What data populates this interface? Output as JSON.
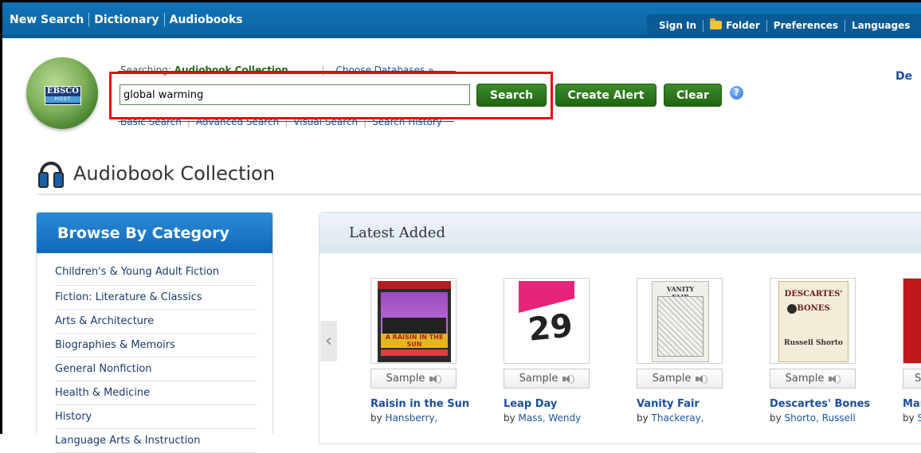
{
  "topnav": {
    "items": [
      "New Search",
      "Dictionary",
      "Audiobooks"
    ]
  },
  "toolbar": {
    "sign_in": "Sign In",
    "folder": "Folder",
    "preferences": "Preferences",
    "languages": "Languages"
  },
  "logo": {
    "line1": "EBSCO",
    "line2": "HOST"
  },
  "search": {
    "searching_label": "Searching:",
    "database": "Audiobook Collection",
    "choose_databases": "Choose Databases »",
    "query": "global warming",
    "search_button": "Search",
    "create_alert_button": "Create Alert",
    "clear_button": "Clear",
    "help": "?",
    "links": [
      "Basic Search",
      "Advanced Search",
      "Visual Search",
      "Search History"
    ]
  },
  "right_link": "De",
  "page_title": "Audiobook Collection",
  "browse": {
    "title": "Browse By Category",
    "categories": [
      "Children's & Young Adult Fiction",
      "Fiction: Literature & Classics",
      "Arts & Architecture",
      "Biographies & Memoirs",
      "General Nonfiction",
      "Health & Medicine",
      "History",
      "Language Arts & Instruction"
    ]
  },
  "latest": {
    "title": "Latest Added",
    "prev_arrow": "‹",
    "sample_label": "Sample",
    "books": [
      {
        "title": "Raisin in the Sun",
        "by": "by",
        "author": "Hansberry,",
        "cover_text": "A RAISIN IN THE SUN"
      },
      {
        "title": "Leap Day",
        "by": "by",
        "author": "Mass, Wendy",
        "cover_text": "29"
      },
      {
        "title": "Vanity Fair",
        "by": "by",
        "author": "Thackeray,",
        "cover_text": "VANITY FAIR"
      },
      {
        "title": "Descartes' Bones",
        "by": "by",
        "author": "Shorto, Russell",
        "cover_text_1": "DESCARTES'",
        "cover_text_2": "BONES",
        "cover_text_3": "Russell Shorto"
      },
      {
        "title": "Mar",
        "by": "by",
        "author": "S"
      }
    ]
  },
  "colors": {
    "nav_blue": "#1173b5",
    "button_green": "#2b7a1e",
    "highlight_red": "#e01010",
    "category_blue": "#1a6fc0"
  }
}
